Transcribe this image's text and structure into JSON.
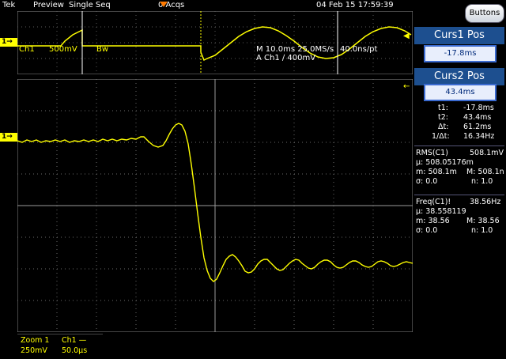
{
  "topbar": {
    "brand": "Tek",
    "mode": "Preview",
    "seq": "Single Seq",
    "acqs": "0 Acqs",
    "datetime": "04 Feb 15 17:59:39"
  },
  "buttons_label": "Buttons",
  "overview": {
    "ch_label": "Ch1",
    "ch_scale": "500mV",
    "bw": "Bw",
    "timebase": "M 10.0ms 25.0MS/s",
    "sample": "40.0ns/pt",
    "trigger": "A  Ch1  ∕  400mV"
  },
  "marker_label": "1→",
  "cursors": {
    "c1_title": "Curs1 Pos",
    "c1_value": "-17.8ms",
    "c2_title": "Curs2 Pos",
    "c2_value": "43.4ms",
    "t1_label": "t1:",
    "t1_value": "-17.8ms",
    "t2_label": "t2:",
    "t2_value": "43.4ms",
    "dt_label": "Δt:",
    "dt_value": "61.2ms",
    "inv_label": "1/Δt:",
    "inv_value": "16.34Hz"
  },
  "rms": {
    "title": "RMS(C1)",
    "value": "508.1mV",
    "mu": "µ: 508.05176m",
    "m": "m: 508.1m",
    "M": "M: 508.1n",
    "sigma": "σ: 0.0",
    "n": "n: 1.0"
  },
  "freq": {
    "title": "Freq(C1)!",
    "value": "38.56Hz",
    "mu": "µ: 38.558119",
    "m": "m: 38.56",
    "M": "M: 38.56",
    "sigma": "σ: 0.0",
    "n": "n: 1.0"
  },
  "bottom": {
    "zoom": "Zoom 1",
    "ch": "Ch1 —",
    "scale": "250mV",
    "time": "50.0µs"
  },
  "colors": {
    "trace": "#ffff00",
    "grid": "#7a7a7a",
    "accent": "#1d4f8f",
    "cursor_marker": "#ff7a00"
  }
}
